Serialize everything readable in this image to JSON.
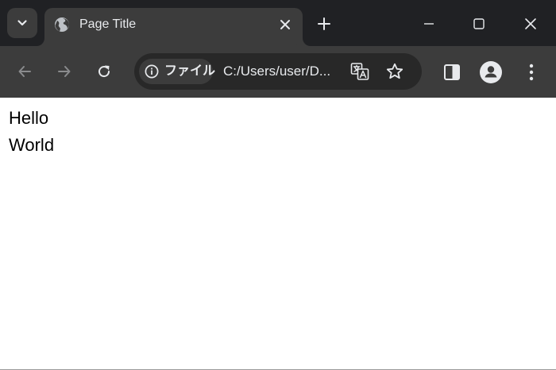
{
  "tab": {
    "title": "Page Title"
  },
  "toolbar": {
    "security_label": "ファイル",
    "url": "C:/Users/user/D..."
  },
  "page": {
    "lines": [
      "Hello",
      "World"
    ]
  },
  "colors": {
    "tabstrip_bg": "#202124",
    "toolbar_bg": "#3c3c3c",
    "omnibox_bg": "#282828",
    "icon_color": "#e8eaed",
    "disabled_icon_color": "#8a8b8d"
  },
  "icons": {
    "tab_search": "chevron-down-icon",
    "favicon": "globe-icon",
    "tab_close": "close-icon",
    "new_tab": "plus-icon",
    "minimize": "minimize-icon",
    "maximize": "maximize-icon",
    "window_close": "close-icon",
    "back": "arrow-left-icon",
    "forward": "arrow-right-icon",
    "reload": "reload-icon",
    "site_info": "info-icon",
    "translate": "translate-icon",
    "bookmark": "star-icon",
    "side_panel": "side-panel-icon",
    "profile": "profile-icon",
    "menu": "more-vert-icon"
  }
}
